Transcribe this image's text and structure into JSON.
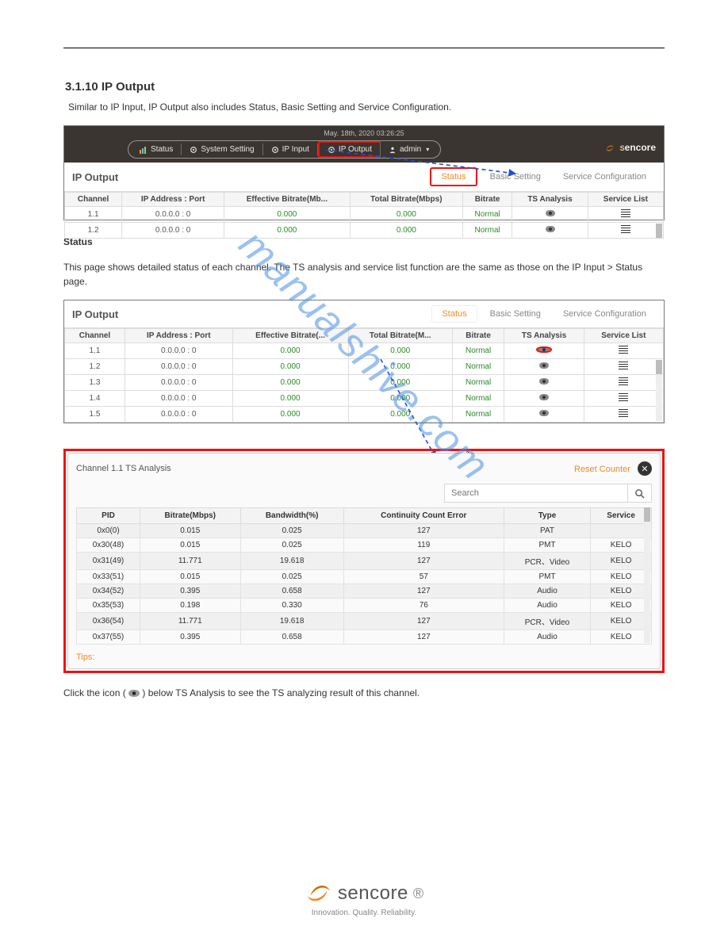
{
  "document": {
    "section_number": "3.1.10",
    "section_title": "IP Output",
    "intro": "Similar to IP Input, IP Output also includes Status, Basic Setting and Service Configuration."
  },
  "shot1": {
    "timestamp": "May. 18th, 2020 03:26:25",
    "brand": "encore",
    "nav": {
      "status": "Status",
      "system": "System Setting",
      "ipin": "IP Input",
      "ipout": "IP Output",
      "user": "admin"
    },
    "panel_title": "IP Output",
    "tabs": {
      "status": "Status",
      "basic": "Basic Setting",
      "service": "Service Configuration"
    },
    "cols": [
      "Channel",
      "IP Address : Port",
      "Effective Bitrate(Mb...",
      "Total Bitrate(Mbps)",
      "Bitrate",
      "TS Analysis",
      "Service List"
    ],
    "rows": [
      {
        "ch": "1.1",
        "addr": "0.0.0.0 : 0",
        "eff": "0.000",
        "tot": "0.000",
        "br": "Normal"
      },
      {
        "ch": "1.2",
        "addr": "0.0.0.0 : 0",
        "eff": "0.000",
        "tot": "0.000",
        "br": "Normal"
      }
    ]
  },
  "status_heading": "Status",
  "status_para1_pre": "This page shows detailed status of each channel. The TS analysis and service list function are the same as those on the IP Input > Status page.",
  "shot2": {
    "panel_title": "IP Output",
    "tabs": {
      "status": "Status",
      "basic": "Basic Setting",
      "service": "Service Configuration"
    },
    "cols": [
      "Channel",
      "IP Address : Port",
      "Effective Bitrate(...",
      "Total Bitrate(M...",
      "Bitrate",
      "TS Analysis",
      "Service List"
    ],
    "rows": [
      {
        "ch": "1.1",
        "addr": "0.0.0.0 : 0",
        "eff": "0.000",
        "tot": "0.000",
        "br": "Normal"
      },
      {
        "ch": "1.2",
        "addr": "0.0.0.0 : 0",
        "eff": "0.000",
        "tot": "0.000",
        "br": "Normal"
      },
      {
        "ch": "1.3",
        "addr": "0.0.0.0 : 0",
        "eff": "0.000",
        "tot": "0.000",
        "br": "Normal"
      },
      {
        "ch": "1.4",
        "addr": "0.0.0.0 : 0",
        "eff": "0.000",
        "tot": "0.000",
        "br": "Normal"
      },
      {
        "ch": "1.5",
        "addr": "0.0.0.0 : 0",
        "eff": "0.000",
        "tot": "0.000",
        "br": "Normal"
      }
    ]
  },
  "ts": {
    "title": "Channel 1.1 TS Analysis",
    "reset": "Reset Counter",
    "search_placeholder": "Search",
    "cols": [
      "PID",
      "Bitrate(Mbps)",
      "Bandwidth(%)",
      "Continuity Count Error",
      "Type",
      "Service"
    ],
    "rows": [
      {
        "pid": "0x0(0)",
        "br": "0.015",
        "bw": "0.025",
        "cc": "127",
        "type": "PAT",
        "svc": ""
      },
      {
        "pid": "0x30(48)",
        "br": "0.015",
        "bw": "0.025",
        "cc": "119",
        "type": "PMT",
        "svc": "KELO"
      },
      {
        "pid": "0x31(49)",
        "br": "11.771",
        "bw": "19.618",
        "cc": "127",
        "type": "PCR、Video",
        "svc": "KELO"
      },
      {
        "pid": "0x33(51)",
        "br": "0.015",
        "bw": "0.025",
        "cc": "57",
        "type": "PMT",
        "svc": "KELO"
      },
      {
        "pid": "0x34(52)",
        "br": "0.395",
        "bw": "0.658",
        "cc": "127",
        "type": "Audio",
        "svc": "KELO"
      },
      {
        "pid": "0x35(53)",
        "br": "0.198",
        "bw": "0.330",
        "cc": "76",
        "type": "Audio",
        "svc": "KELO"
      },
      {
        "pid": "0x36(54)",
        "br": "11.771",
        "bw": "19.618",
        "cc": "127",
        "type": "PCR、Video",
        "svc": "KELO"
      },
      {
        "pid": "0x37(55)",
        "br": "0.395",
        "bw": "0.658",
        "cc": "127",
        "type": "Audio",
        "svc": "KELO"
      }
    ],
    "tips": "Tips:"
  },
  "eyeline_pre": "Click the icon ( ",
  "eyeline_post": " ) below TS Analysis to see the TS analyzing result of this channel.",
  "watermark": "manualshive.com",
  "footer": {
    "brand": "sencore",
    "tag": "Innovation. Quality. Reliability."
  }
}
